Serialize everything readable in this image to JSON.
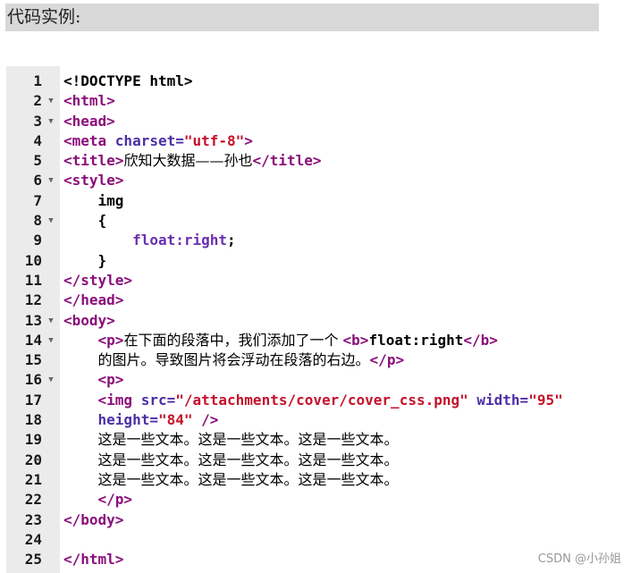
{
  "heading": "代码实例:",
  "editor": {
    "lines": [
      {
        "n": "1",
        "fold": false,
        "tokens": [
          {
            "c": "plain",
            "t": "<!DOCTYPE html>"
          }
        ]
      },
      {
        "n": "2",
        "fold": true,
        "tokens": [
          {
            "c": "tag",
            "t": "<html>"
          }
        ]
      },
      {
        "n": "3",
        "fold": true,
        "tokens": [
          {
            "c": "tag",
            "t": "<head>"
          }
        ]
      },
      {
        "n": "4",
        "fold": false,
        "tokens": [
          {
            "c": "tag",
            "t": "<meta "
          },
          {
            "c": "attr",
            "t": "charset="
          },
          {
            "c": "val",
            "t": "\"utf-8\""
          },
          {
            "c": "tag",
            "t": ">"
          }
        ]
      },
      {
        "n": "5",
        "fold": false,
        "tokens": [
          {
            "c": "tag",
            "t": "<title>"
          },
          {
            "c": "text",
            "t": "欣知大数据——孙也"
          },
          {
            "c": "tag",
            "t": "</title>"
          }
        ]
      },
      {
        "n": "6",
        "fold": true,
        "tokens": [
          {
            "c": "tag",
            "t": "<style>"
          }
        ]
      },
      {
        "n": "7",
        "fold": false,
        "tokens": [
          {
            "c": "plain",
            "t": "    img"
          }
        ]
      },
      {
        "n": "8",
        "fold": true,
        "tokens": [
          {
            "c": "plain",
            "t": "    {"
          }
        ]
      },
      {
        "n": "9",
        "fold": false,
        "tokens": [
          {
            "c": "plain",
            "t": "        "
          },
          {
            "c": "prop",
            "t": "float:right"
          },
          {
            "c": "plain",
            "t": ";"
          }
        ]
      },
      {
        "n": "10",
        "fold": false,
        "tokens": [
          {
            "c": "plain",
            "t": "    }"
          }
        ]
      },
      {
        "n": "11",
        "fold": false,
        "tokens": [
          {
            "c": "tag",
            "t": "</style>"
          }
        ]
      },
      {
        "n": "12",
        "fold": false,
        "tokens": [
          {
            "c": "tag",
            "t": "</head>"
          }
        ]
      },
      {
        "n": "13",
        "fold": true,
        "tokens": [
          {
            "c": "tag",
            "t": "<body>"
          }
        ]
      },
      {
        "n": "14",
        "fold": true,
        "tokens": [
          {
            "c": "plain",
            "t": "    "
          },
          {
            "c": "tag",
            "t": "<p>"
          },
          {
            "c": "text",
            "t": "在下面的段落中，我们添加了一个 "
          },
          {
            "c": "tag",
            "t": "<b>"
          },
          {
            "c": "plain",
            "t": "float:right"
          },
          {
            "c": "tag",
            "t": "</b>"
          }
        ]
      },
      {
        "n": "15",
        "fold": false,
        "tokens": [
          {
            "c": "plain",
            "t": "    "
          },
          {
            "c": "text",
            "t": "的图片。导致图片将会浮动在段落的右边。"
          },
          {
            "c": "tag",
            "t": "</p>"
          }
        ]
      },
      {
        "n": "16",
        "fold": true,
        "tokens": [
          {
            "c": "plain",
            "t": "    "
          },
          {
            "c": "tag",
            "t": "<p>"
          }
        ]
      },
      {
        "n": "17",
        "fold": false,
        "tokens": [
          {
            "c": "plain",
            "t": "    "
          },
          {
            "c": "tag",
            "t": "<img "
          },
          {
            "c": "attr",
            "t": "src="
          },
          {
            "c": "val",
            "t": "\"/attachments/cover/cover_css.png\""
          },
          {
            "c": "attr",
            "t": " width="
          },
          {
            "c": "val",
            "t": "\"95\""
          }
        ]
      },
      {
        "n": "18",
        "fold": false,
        "tokens": [
          {
            "c": "plain",
            "t": "    "
          },
          {
            "c": "attr",
            "t": "height="
          },
          {
            "c": "val",
            "t": "\"84\""
          },
          {
            "c": "tag",
            "t": " />"
          }
        ]
      },
      {
        "n": "19",
        "fold": false,
        "tokens": [
          {
            "c": "plain",
            "t": "    "
          },
          {
            "c": "text",
            "t": "这是一些文本。这是一些文本。这是一些文本。"
          }
        ]
      },
      {
        "n": "20",
        "fold": false,
        "tokens": [
          {
            "c": "plain",
            "t": "    "
          },
          {
            "c": "text",
            "t": "这是一些文本。这是一些文本。这是一些文本。"
          }
        ]
      },
      {
        "n": "21",
        "fold": false,
        "tokens": [
          {
            "c": "plain",
            "t": "    "
          },
          {
            "c": "text",
            "t": "这是一些文本。这是一些文本。这是一些文本。"
          }
        ]
      },
      {
        "n": "22",
        "fold": false,
        "tokens": [
          {
            "c": "plain",
            "t": "    "
          },
          {
            "c": "tag",
            "t": "</p>"
          }
        ]
      },
      {
        "n": "23",
        "fold": false,
        "tokens": [
          {
            "c": "tag",
            "t": "</body>"
          }
        ]
      },
      {
        "n": "24",
        "fold": false,
        "tokens": []
      },
      {
        "n": "25",
        "fold": false,
        "tokens": [
          {
            "c": "tag",
            "t": "</html>"
          }
        ]
      }
    ],
    "fold_glyph": "▼"
  },
  "watermark": "CSDN @小孙姐",
  "colors": {
    "tag": "#8b0e7a",
    "attr": "#4b2fa6",
    "value": "#c4122b",
    "property": "#6a2fb0",
    "gutter": "#ebebeb",
    "heading_bg": "#d8d8d8"
  }
}
